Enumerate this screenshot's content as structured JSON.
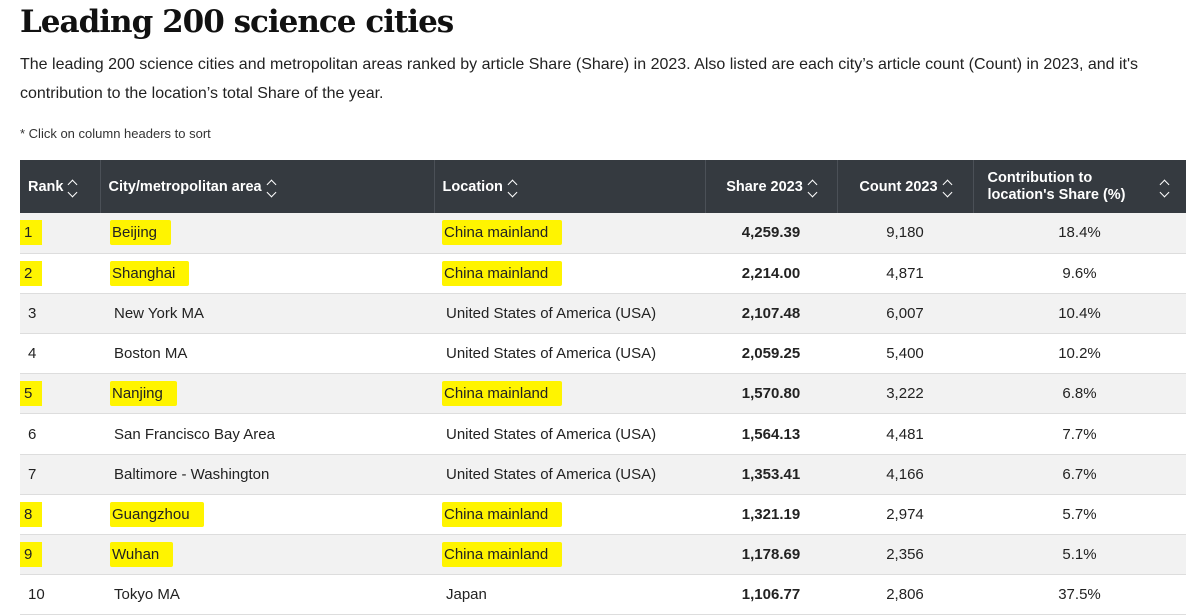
{
  "header": {
    "title": "Leading 200 science cities",
    "description": "The leading 200 science cities and metropolitan areas ranked by article Share (Share) in 2023. Also listed are each city’s article count (Count) in 2023, and it's contribution to the location’s total Share of the year.",
    "hint": "* Click on column headers to sort"
  },
  "table": {
    "columns": [
      "Rank",
      "City/metropolitan area",
      "Location",
      "Share 2023",
      "Count 2023",
      "Contribution to location's Share (%)"
    ],
    "highlight_color": "#fff400",
    "rows": [
      {
        "rank": "1",
        "city": "Beijing",
        "location": "China mainland",
        "share": "4,259.39",
        "count": "9,180",
        "contrib": "18.4%",
        "highlighted": true
      },
      {
        "rank": "2",
        "city": "Shanghai",
        "location": "China mainland",
        "share": "2,214.00",
        "count": "4,871",
        "contrib": "9.6%",
        "highlighted": true
      },
      {
        "rank": "3",
        "city": "New York MA",
        "location": "United States of America (USA)",
        "share": "2,107.48",
        "count": "6,007",
        "contrib": "10.4%",
        "highlighted": false
      },
      {
        "rank": "4",
        "city": "Boston MA",
        "location": "United States of America (USA)",
        "share": "2,059.25",
        "count": "5,400",
        "contrib": "10.2%",
        "highlighted": false
      },
      {
        "rank": "5",
        "city": "Nanjing",
        "location": "China mainland",
        "share": "1,570.80",
        "count": "3,222",
        "contrib": "6.8%",
        "highlighted": true
      },
      {
        "rank": "6",
        "city": "San Francisco Bay Area",
        "location": "United States of America (USA)",
        "share": "1,564.13",
        "count": "4,481",
        "contrib": "7.7%",
        "highlighted": false
      },
      {
        "rank": "7",
        "city": "Baltimore - Washington",
        "location": "United States of America (USA)",
        "share": "1,353.41",
        "count": "4,166",
        "contrib": "6.7%",
        "highlighted": false
      },
      {
        "rank": "8",
        "city": "Guangzhou",
        "location": "China mainland",
        "share": "1,321.19",
        "count": "2,974",
        "contrib": "5.7%",
        "highlighted": true
      },
      {
        "rank": "9",
        "city": "Wuhan",
        "location": "China mainland",
        "share": "1,178.69",
        "count": "2,356",
        "contrib": "5.1%",
        "highlighted": true
      },
      {
        "rank": "10",
        "city": "Tokyo MA",
        "location": "Japan",
        "share": "1,106.77",
        "count": "2,806",
        "contrib": "37.5%",
        "highlighted": false
      }
    ]
  }
}
